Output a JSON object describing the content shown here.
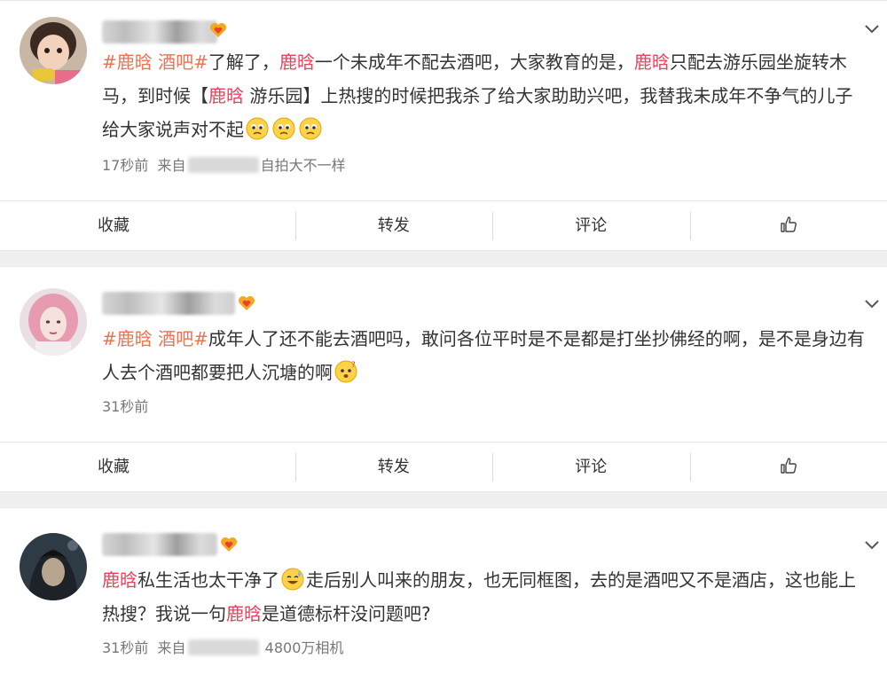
{
  "posts": [
    {
      "tags": [
        "#鹿晗 酒吧#"
      ],
      "segments": {
        "t1": "#鹿晗 酒吧#",
        "s1": "了解了，",
        "h1": "鹿晗",
        "s2": "一个未成年不配去酒吧，大家教育的是，",
        "h2": "鹿晗",
        "s3": "只配去游乐园坐旋转木马，到时候【",
        "h3": "鹿晗",
        "s4": " 游乐园】上热搜的时候把我杀了给大家助助兴吧，我替我未成年不争气的儿子给大家说声对不起"
      },
      "time": "17秒前",
      "source_prefix": "来自",
      "source_suffix": "自拍大不一样"
    },
    {
      "segments": {
        "t1": "#鹿晗 酒吧#",
        "s1": "成年人了还不能去酒吧吗，敢问各位平时是不是都是打坐抄佛经的啊，是不是身边有人去个酒吧都要把人沉塘的啊"
      },
      "time": "31秒前"
    },
    {
      "segments": {
        "h1": "鹿晗",
        "s1": "私生活也太干净了",
        "s2": "走后别人叫来的朋友，也无同框图，去的是酒吧又不是酒店，这也能上热搜？我说一句",
        "h2": "鹿晗",
        "s3": "是道德标杆没问题吧?"
      },
      "time": "31秒前",
      "source_prefix": "来自",
      "source_suffix": "4800万相机"
    }
  ],
  "actions": {
    "favorite": "收藏",
    "repost": "转发",
    "comment": "评论"
  },
  "icons": {
    "like": "thumbs-up-icon",
    "menu": "chevron-down-icon",
    "vip": "vip-heart-icon",
    "emoji_pleading": "pleading-emoji-icon",
    "emoji_confused": "confused-emoji-icon",
    "emoji_sweat": "sweat-smile-emoji-icon"
  },
  "colors": {
    "highlight": "#eb3f5a",
    "topic": "#eb7350",
    "text": "#333333",
    "meta": "#777777"
  }
}
